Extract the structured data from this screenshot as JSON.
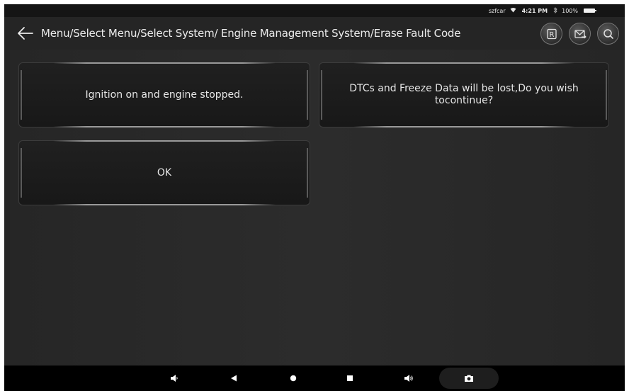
{
  "statusbar": {
    "carrier": "szfcar",
    "wifi_icon": "wifi-icon",
    "time": "4:21 PM",
    "bluetooth_icon": "bluetooth-icon",
    "battery": "100%"
  },
  "header": {
    "breadcrumb": "Menu/Select Menu/Select System/ Engine Management System/Erase Fault Code",
    "back_icon": "arrow-left-icon",
    "actions": [
      {
        "name": "report-button",
        "icon": "r-box-icon"
      },
      {
        "name": "mail-button",
        "icon": "mail-icon"
      },
      {
        "name": "search-button",
        "icon": "search-icon"
      }
    ]
  },
  "messages": {
    "ignition": "Ignition on and engine stopped.",
    "warning": "DTCs and Freeze Data will be lost,Do you wish tocontinue?",
    "ok_label": "OK"
  },
  "navbar": {
    "icons": [
      "volume-down-icon",
      "back-triangle-icon",
      "home-dot-icon",
      "recents-square-icon",
      "volume-up-icon",
      "camera-icon"
    ]
  },
  "colors": {
    "background": "#282828",
    "card": "#1c1c1c",
    "text": "#e6e6e6",
    "navbar": "#000000"
  }
}
